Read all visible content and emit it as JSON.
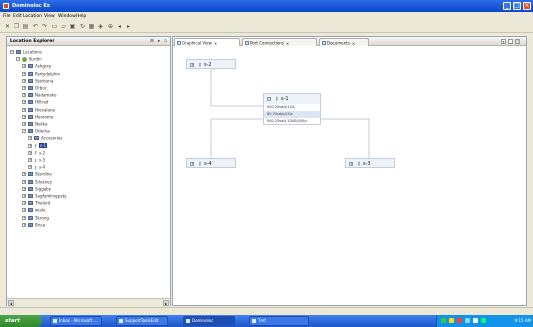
{
  "window": {
    "title": "Dominoloc Ex"
  },
  "menu": [
    "File",
    "Edit",
    "Location",
    "View",
    "Window",
    "Help"
  ],
  "toolbar_icons": [
    "cut-icon",
    "copy-icon",
    "paste-icon",
    "undo-icon",
    "redo-icon",
    "new-icon",
    "open-icon",
    "save-icon",
    "refresh-icon",
    "print-icon",
    "graph-icon",
    "zoom-icon",
    "back-icon",
    "forward-icon"
  ],
  "location_explorer": {
    "title": "Location Explorer",
    "tree": [
      {
        "label": "Locations",
        "level": 0,
        "icon": "folder",
        "expander": "−"
      },
      {
        "label": "Kurdin",
        "level": 1,
        "icon": "globe",
        "expander": "−"
      },
      {
        "label": "Ashgrey",
        "level": 2,
        "icon": "folder",
        "expander": "+"
      },
      {
        "label": "Partydolphin",
        "level": 2,
        "icon": "folder",
        "expander": "+"
      },
      {
        "label": "Starbuna",
        "level": 2,
        "icon": "folder",
        "expander": "+"
      },
      {
        "label": "Orbur",
        "level": 2,
        "icon": "folder",
        "expander": "+"
      },
      {
        "label": "Nadamako",
        "level": 2,
        "icon": "folder",
        "expander": "+"
      },
      {
        "label": "Hiltrad",
        "level": 2,
        "icon": "folder",
        "expander": "+"
      },
      {
        "label": "Hievalana",
        "level": 2,
        "icon": "folder",
        "expander": "+"
      },
      {
        "label": "Heroome",
        "level": 2,
        "icon": "folder",
        "expander": "+"
      },
      {
        "label": "Nokka",
        "level": 2,
        "icon": "folder",
        "expander": "+"
      },
      {
        "label": "Oderna",
        "level": 2,
        "icon": "folder",
        "expander": "−"
      },
      {
        "label": "Accesories",
        "level": 3,
        "icon": "folder",
        "expander": "+"
      },
      {
        "label": "s-1",
        "level": 3,
        "icon": "key",
        "expander": "+",
        "selected": true
      },
      {
        "label": "s-2",
        "level": 3,
        "icon": "key",
        "expander": "+"
      },
      {
        "label": "s-3",
        "level": 3,
        "icon": "key",
        "expander": "+"
      },
      {
        "label": "s-4",
        "level": 3,
        "icon": "key",
        "expander": "+"
      },
      {
        "label": "Stardine",
        "level": 2,
        "icon": "folder",
        "expander": "+"
      },
      {
        "label": "Silvaney",
        "level": 2,
        "icon": "folder",
        "expander": "+"
      },
      {
        "label": "Siggaby",
        "level": 2,
        "icon": "folder",
        "expander": "+"
      },
      {
        "label": "Sagfamlingpaty",
        "level": 2,
        "icon": "folder",
        "expander": "+"
      },
      {
        "label": "Thelord",
        "level": 2,
        "icon": "folder",
        "expander": "+"
      },
      {
        "label": "wiale",
        "level": 2,
        "icon": "folder",
        "expander": "+"
      },
      {
        "label": "Skrong",
        "level": 2,
        "icon": "folder",
        "expander": "+"
      },
      {
        "label": "Brica",
        "level": 2,
        "icon": "folder",
        "expander": "+"
      }
    ]
  },
  "tabs": [
    {
      "label": "Graphical View",
      "active": true
    },
    {
      "label": "Port Connections",
      "active": false
    },
    {
      "label": "Documents",
      "active": false
    }
  ],
  "graph": {
    "nodes": [
      {
        "id": "top",
        "label": "s-2"
      },
      {
        "id": "center",
        "label": "s-1",
        "ports": [
          "000 25sd/s/12/c",
          "60 25sd/s/24/c",
          "000 25sd/s 1000/000/c"
        ]
      },
      {
        "id": "left",
        "label": "s-4"
      },
      {
        "id": "right",
        "label": "s-3"
      }
    ]
  },
  "taskbar": {
    "start": "start",
    "buttons": [
      "Inbox - Microsoft ...",
      "SupportToolsEdit",
      "Dominoloc",
      "Tmf"
    ],
    "clock": "9:15 AM",
    "tray_colors": [
      "#2ecc40",
      "#ffdc00",
      "#ff4136",
      "#7fdbff",
      "#ffffff",
      "#01ff70"
    ]
  }
}
